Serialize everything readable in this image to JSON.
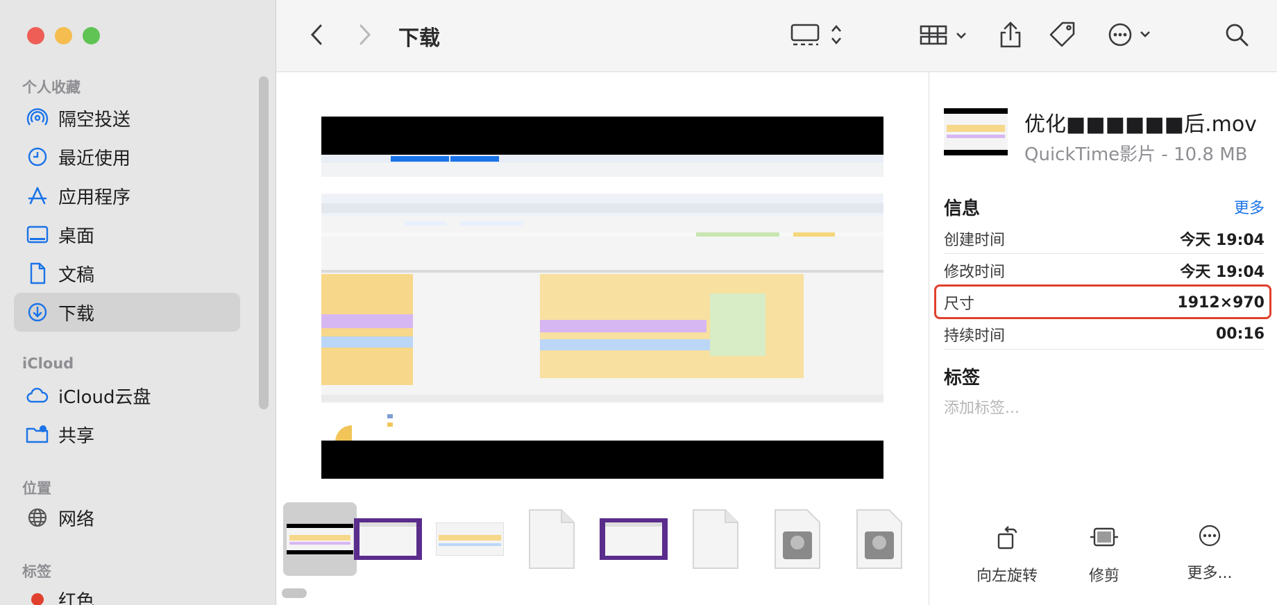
{
  "window": {
    "title": "下载"
  },
  "sidebar": {
    "sections": {
      "favorites": "个人收藏",
      "icloud": "iCloud",
      "locations": "位置",
      "tags": "标签"
    },
    "items": [
      {
        "label": "隔空投送",
        "icon": "airdrop-icon"
      },
      {
        "label": "最近使用",
        "icon": "clock-icon"
      },
      {
        "label": "应用程序",
        "icon": "applications-icon"
      },
      {
        "label": "桌面",
        "icon": "desktop-icon"
      },
      {
        "label": "文稿",
        "icon": "document-icon"
      },
      {
        "label": "下载",
        "icon": "download-icon",
        "selected": true
      },
      {
        "label": "iCloud云盘",
        "icon": "cloud-icon"
      },
      {
        "label": "共享",
        "icon": "shared-folder-icon"
      },
      {
        "label": "网络",
        "icon": "network-icon"
      },
      {
        "label": "红色",
        "icon": "red-tag-icon"
      }
    ]
  },
  "inspector": {
    "filename": "优化■■■■■■后.mov",
    "kind": "QuickTime影片 - 10.8 MB",
    "info_header": "信息",
    "more_link": "更多",
    "rows": [
      {
        "key": "创建时间",
        "value": "今天 19:04"
      },
      {
        "key": "修改时间",
        "value": "今天 19:04"
      },
      {
        "key": "尺寸",
        "value": "1912×970"
      },
      {
        "key": "持续时间",
        "value": "00:16"
      }
    ],
    "tags_header": "标签",
    "tags_placeholder": "添加标签...",
    "actions": {
      "rotate": "向左旋转",
      "trim": "修剪",
      "more": "更多..."
    }
  },
  "colors": {
    "accent": "#1a73e8",
    "highlight": "#e0402d",
    "close": "#ee5e57",
    "minimize": "#f5bd4f",
    "zoom": "#5fc454"
  }
}
